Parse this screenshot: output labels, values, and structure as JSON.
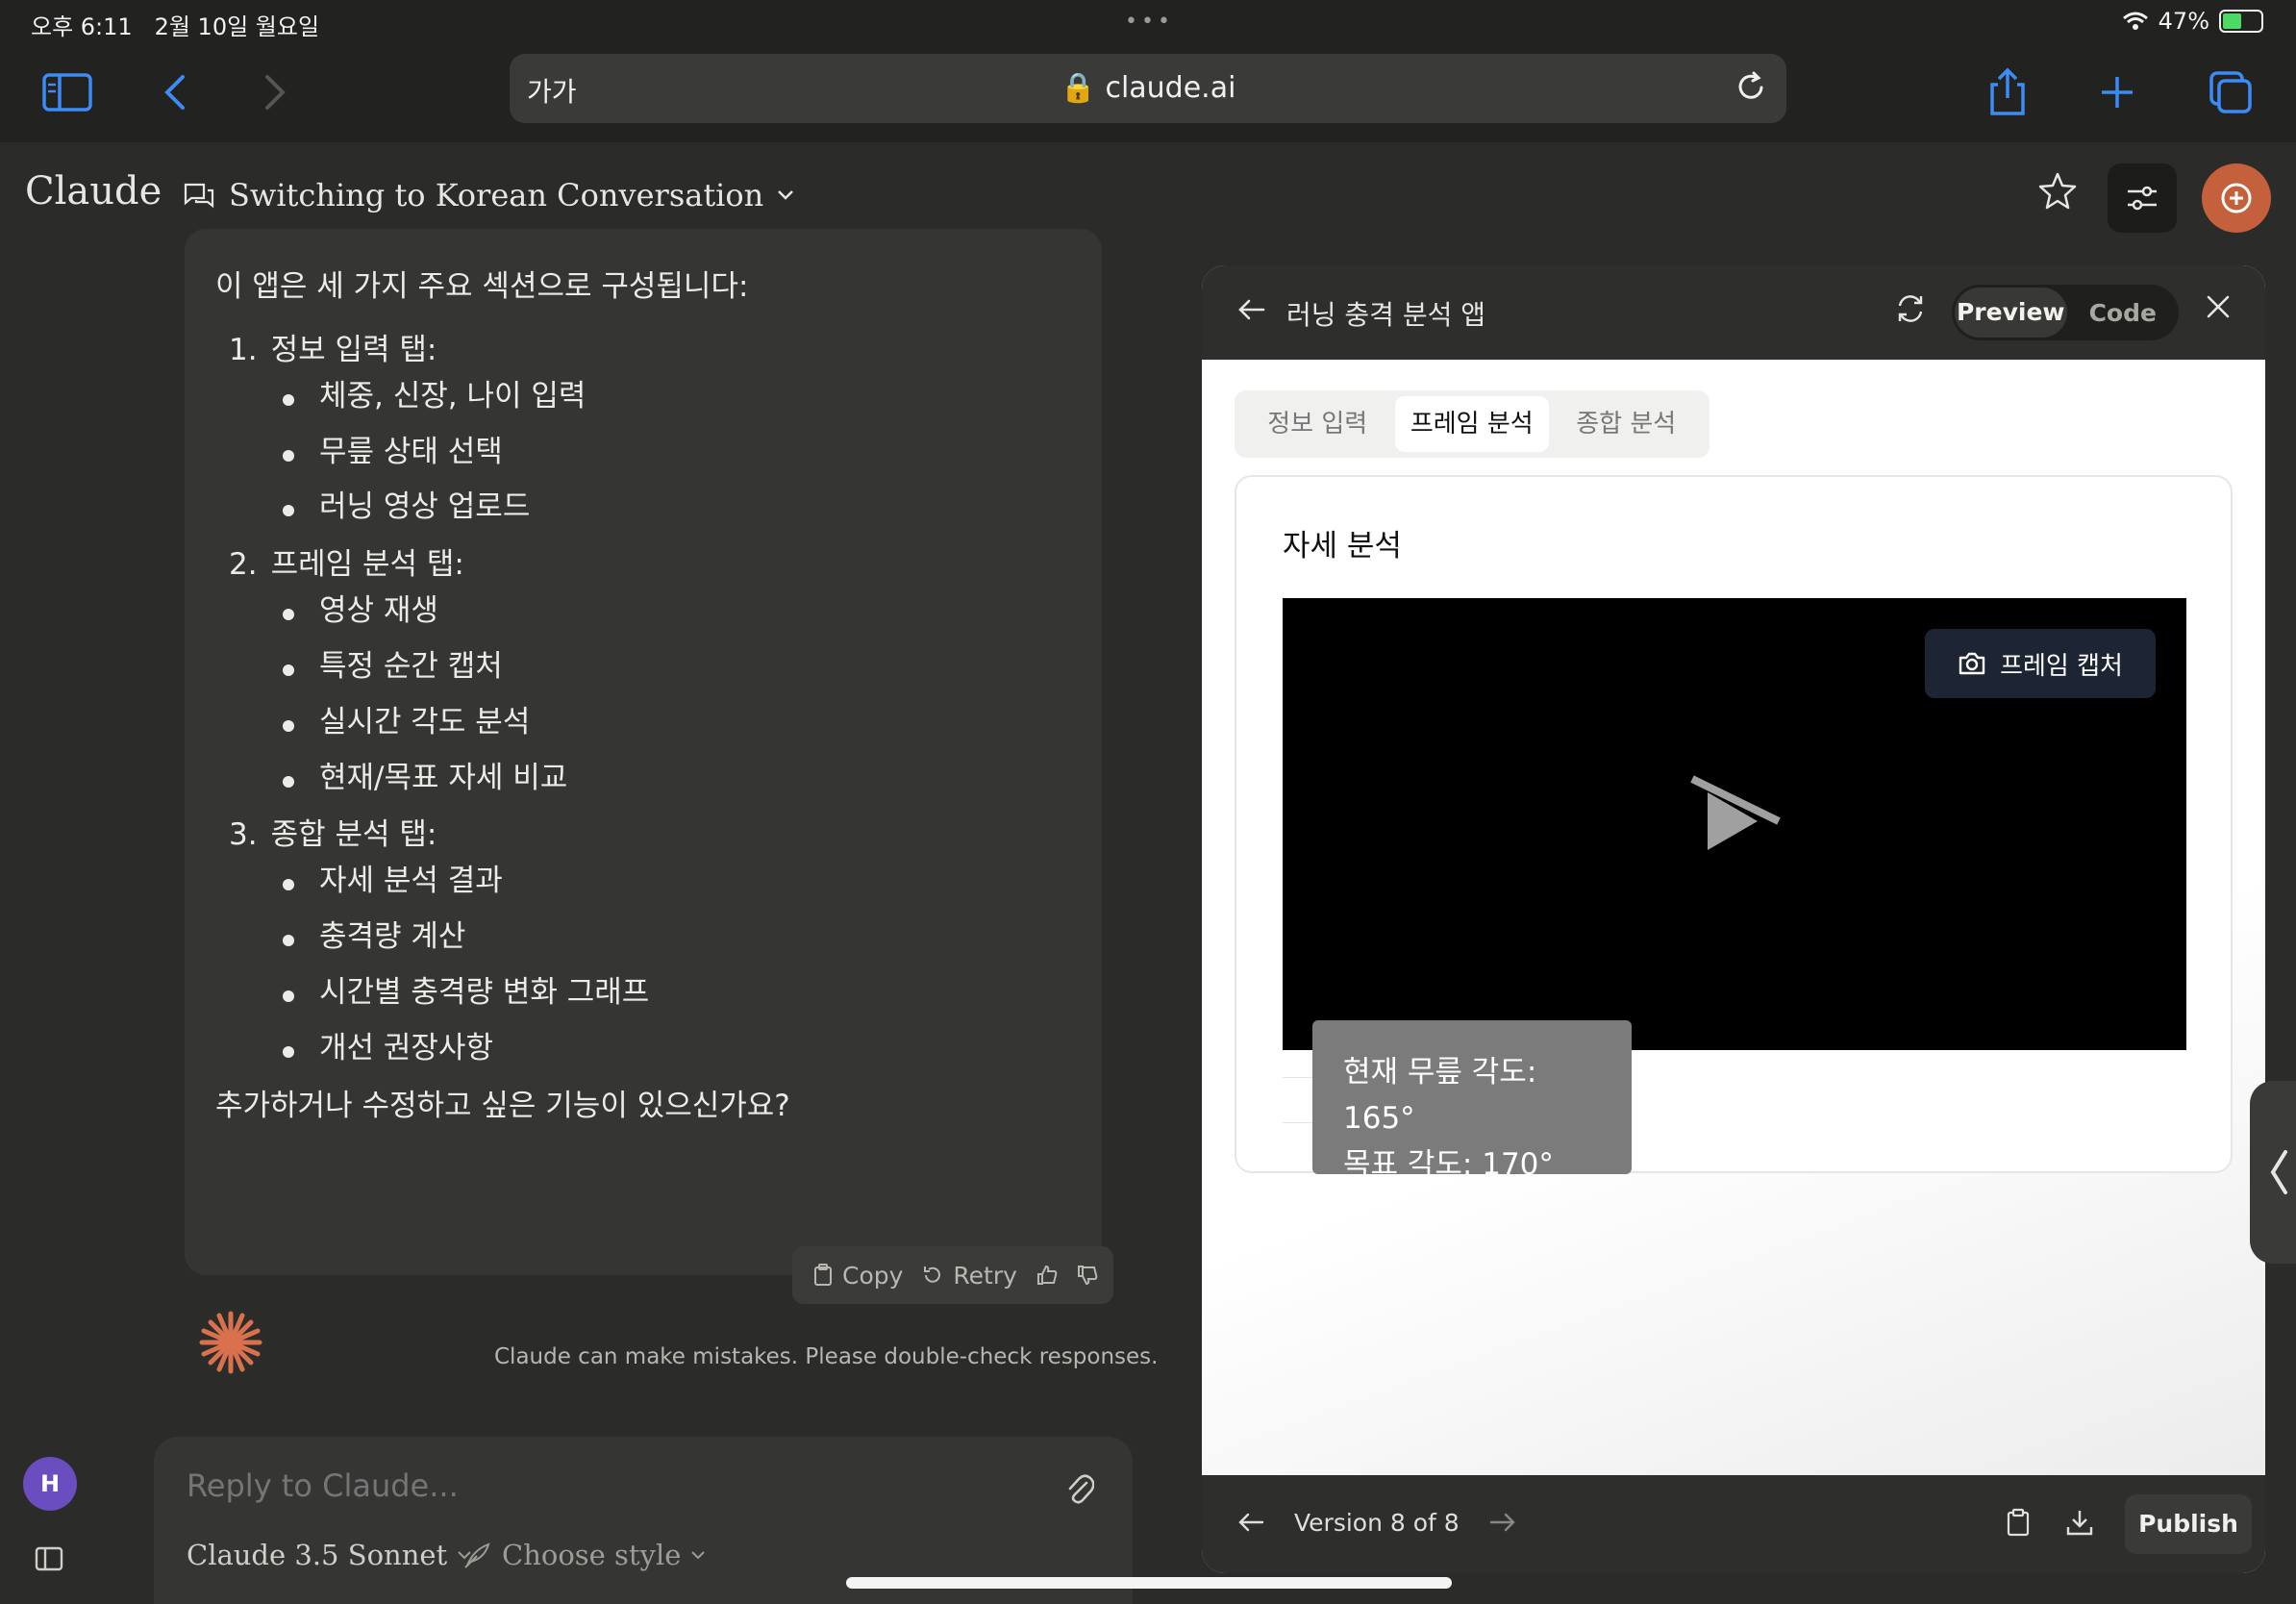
{
  "status": {
    "time": "오후 6:11",
    "date": "2월 10일 월요일",
    "battery": "47%"
  },
  "browser": {
    "text_size": "가가",
    "url": "claude.ai"
  },
  "header": {
    "logo": "Claude",
    "conversation_title": "Switching to Korean Conversation"
  },
  "message": {
    "intro": "이 앱은 세 가지 주요 섹션으로 구성됩니다:",
    "sections": [
      {
        "num": "1.",
        "title": "정보 입력 탭:",
        "items": [
          "체중, 신장, 나이 입력",
          "무릎 상태 선택",
          "러닝 영상 업로드"
        ]
      },
      {
        "num": "2.",
        "title": "프레임 분석 탭:",
        "items": [
          "영상 재생",
          "특정 순간 캡처",
          "실시간 각도 분석",
          "현재/목표 자세 비교"
        ]
      },
      {
        "num": "3.",
        "title": "종합 분석 탭:",
        "items": [
          "자세 분석 결과",
          "충격량 계산",
          "시간별 충격량 변화 그래프",
          "개선 권장사항"
        ]
      }
    ],
    "outro": "추가하거나 수정하고 싶은 기능이 있으신가요?",
    "actions": {
      "copy": "Copy",
      "retry": "Retry"
    }
  },
  "disclaimer": "Claude can make mistakes. Please double-check responses.",
  "reply": {
    "placeholder": "Reply to Claude...",
    "model": "Claude 3.5 Sonnet",
    "style": "Choose style"
  },
  "user": {
    "initial": "H"
  },
  "artifact": {
    "title": "러닝 충격 분석 앱",
    "toggle": {
      "preview": "Preview",
      "code": "Code",
      "selected": "Preview"
    },
    "tabs": [
      "정보 입력",
      "프레임 분석",
      "종합 분석"
    ],
    "active_tab": "프레임 분석",
    "card_title": "자세 분석",
    "capture_label": "프레임 캡처",
    "broken_image_glyph": "?",
    "tooltip": {
      "current": "현재 무릎 각도: 165°",
      "target": "목표 각도: 170°"
    },
    "version": "Version 8 of 8",
    "publish": "Publish"
  },
  "colors": {
    "background": "#2b2b29",
    "accent": "#c4603b",
    "panel": "#353533",
    "capture_button": "#1d2433"
  }
}
